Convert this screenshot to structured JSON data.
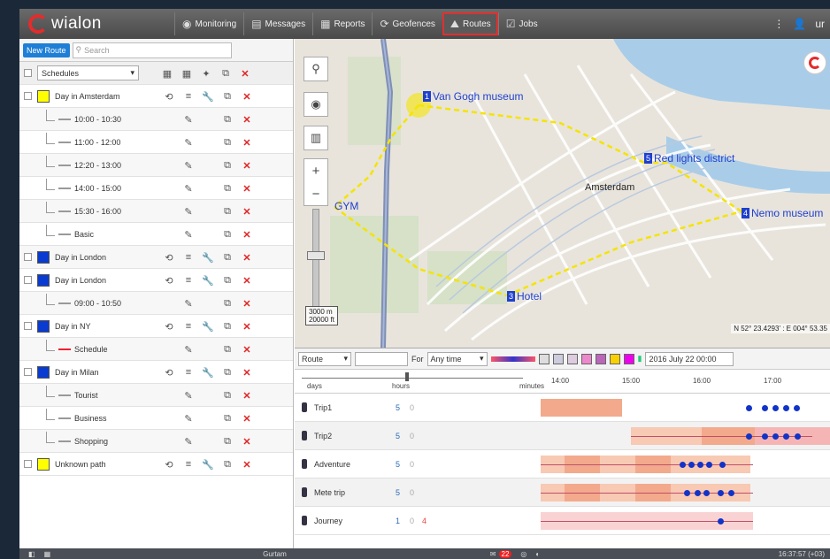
{
  "app": {
    "logo_text": "wialon"
  },
  "nav": [
    {
      "label": "Monitoring",
      "icon": "monitoring-icon",
      "glyph": "◉"
    },
    {
      "label": "Messages",
      "icon": "messages-icon",
      "glyph": "▤"
    },
    {
      "label": "Reports",
      "icon": "reports-icon",
      "glyph": "▦"
    },
    {
      "label": "Geofences",
      "icon": "geofences-icon",
      "glyph": "⟳"
    },
    {
      "label": "Routes",
      "icon": "routes-icon",
      "glyph": "⛰",
      "active": true
    },
    {
      "label": "Jobs",
      "icon": "jobs-icon",
      "glyph": "☑"
    }
  ],
  "topright": {
    "user_initial": "ur"
  },
  "left": {
    "new_route_label": "New Route",
    "search_placeholder": "Search",
    "filter_value": "Schedules",
    "rows": [
      {
        "type": "route",
        "name": "Day in Amsterdam",
        "color": "#ffff00"
      },
      {
        "type": "child",
        "name": "10:00 - 10:30"
      },
      {
        "type": "child",
        "name": "11:00 - 12:00"
      },
      {
        "type": "child",
        "name": "12:20 - 13:00"
      },
      {
        "type": "child",
        "name": "14:00 - 15:00"
      },
      {
        "type": "child",
        "name": "15:30 - 16:00"
      },
      {
        "type": "child",
        "name": "Basic"
      },
      {
        "type": "route",
        "name": "Day in London",
        "color": "#0a3bd0"
      },
      {
        "type": "route",
        "name": "Day in London",
        "color": "#0a3bd0"
      },
      {
        "type": "child",
        "name": "09:00 - 10:50"
      },
      {
        "type": "route",
        "name": "Day in NY",
        "color": "#0a3bd0"
      },
      {
        "type": "child",
        "name": "Schedule",
        "red": true
      },
      {
        "type": "route",
        "name": "Day in Milan",
        "color": "#0a3bd0"
      },
      {
        "type": "child",
        "name": "Tourist"
      },
      {
        "type": "child",
        "name": "Business"
      },
      {
        "type": "child",
        "name": "Shopping"
      },
      {
        "type": "route",
        "name": "Unknown path",
        "color": "#ffff00"
      }
    ]
  },
  "map": {
    "poi": [
      {
        "num": "1",
        "label": "Van Gogh museum"
      },
      {
        "num": "5",
        "label": "Red lights district"
      },
      {
        "num": "4",
        "label": "Nemo museum"
      },
      {
        "num": "3",
        "label": "Hotel"
      },
      {
        "num": "",
        "label": "GYM"
      }
    ],
    "city_label": "Amsterdam",
    "scale_m": "3000 m",
    "scale_ft": "20000 ft",
    "coords": "N 52° 23.4293' : E 004° 53.35"
  },
  "timeline": {
    "type_value": "Route",
    "for_label": "For",
    "period_value": "Any time",
    "date_value": "2016 July 22 00:00",
    "scale_labels": [
      "days",
      "hours",
      "minutes"
    ],
    "times": [
      "14:00",
      "15:00",
      "16:00",
      "17:00"
    ],
    "rows": [
      {
        "name": "Trip1",
        "n1": "5",
        "n2": "0"
      },
      {
        "name": "Trip2",
        "n1": "5",
        "n2": "0"
      },
      {
        "name": "Adventure",
        "n1": "5",
        "n2": "0"
      },
      {
        "name": "Mete trip",
        "n1": "5",
        "n2": "0"
      },
      {
        "name": "Journey",
        "n1": "1",
        "n2": "0",
        "n3": "4"
      }
    ]
  },
  "statusbar": {
    "center": "Gurtam",
    "badge_count": "22",
    "time": "16:37:57 (+03)"
  }
}
